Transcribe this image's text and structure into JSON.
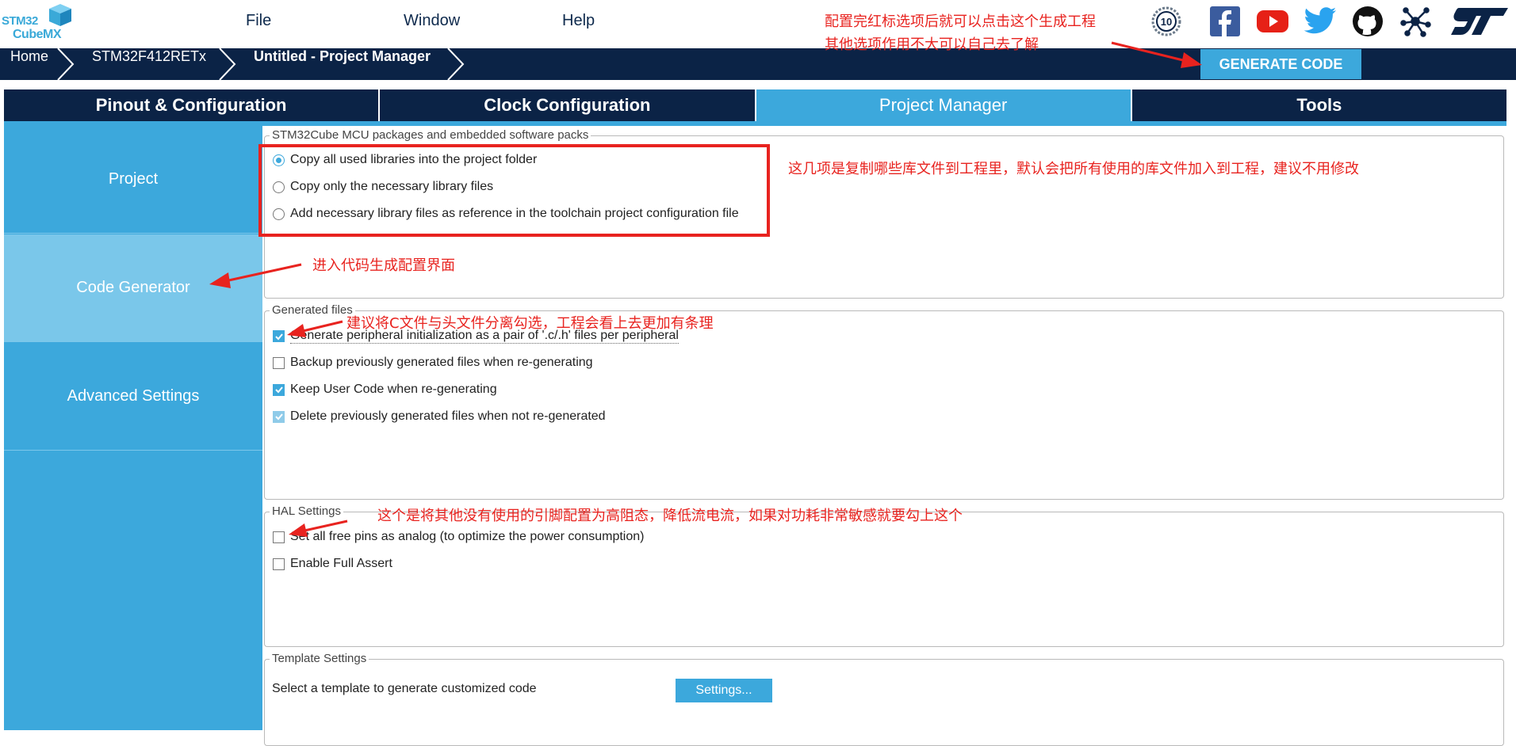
{
  "app": {
    "logo_line1_a": "STM32",
    "logo_line1_b": "",
    "logo_line2": "CubeMX",
    "menu": [
      "File",
      "Window",
      "Help"
    ]
  },
  "social_icons": [
    "anniversary-10-icon",
    "facebook-icon",
    "youtube-icon",
    "twitter-icon",
    "github-icon",
    "network-icon",
    "st-logo-icon"
  ],
  "breadcrumb": [
    "Home",
    "STM32F412RETx",
    "Untitled - Project Manager"
  ],
  "generate_button": "GENERATE CODE",
  "tabs": [
    "Pinout & Configuration",
    "Clock Configuration",
    "Project Manager",
    "Tools"
  ],
  "active_tab": "Project Manager",
  "sidebar": {
    "items": [
      "Project",
      "Code Generator",
      "Advanced Settings"
    ],
    "active": "Code Generator"
  },
  "packages": {
    "legend": "STM32Cube MCU packages and embedded software packs",
    "options": [
      "Copy all used libraries into the project folder",
      "Copy only the necessary library files",
      "Add necessary library files as reference in the toolchain project configuration file"
    ],
    "selected_index": 0
  },
  "generated_files": {
    "legend": "Generated files",
    "options": [
      {
        "label": "Generate peripheral initialization as a pair of '.c/.h' files per peripheral",
        "checked": true
      },
      {
        "label": "Backup previously generated files when re-generating",
        "checked": false
      },
      {
        "label": "Keep User Code when re-generating",
        "checked": true
      },
      {
        "label": "Delete previously generated files when not re-generated",
        "checked": true
      }
    ]
  },
  "hal_settings": {
    "legend": "HAL Settings",
    "options": [
      {
        "label": "Set all free pins as analog (to optimize the power consumption)",
        "checked": false
      },
      {
        "label": "Enable Full Assert",
        "checked": false
      }
    ]
  },
  "template_settings": {
    "legend": "Template Settings",
    "description": "Select a template to generate customized code",
    "button": "Settings..."
  },
  "annotations": {
    "generate_line1": "配置完红标选项后就可以点击这个生成工程",
    "generate_line2": "其他选项作用不大可以自己去了解",
    "libraries": "这几项是复制哪些库文件到工程里，默认会把所有使用的库文件加入到工程，建议不用修改",
    "code_generator": "进入代码生成配置界面",
    "separate_files": "建议将C文件与头文件分离勾选，工程会看上去更加有条理",
    "free_pins": "这个是将其他没有使用的引脚配置为高阻态，降低流电流，如果对功耗非常敏感就要勾上这个"
  },
  "colors": {
    "navy": "#0b2346",
    "accent": "#3ca8dc",
    "annotation_red": "#e8231f"
  }
}
